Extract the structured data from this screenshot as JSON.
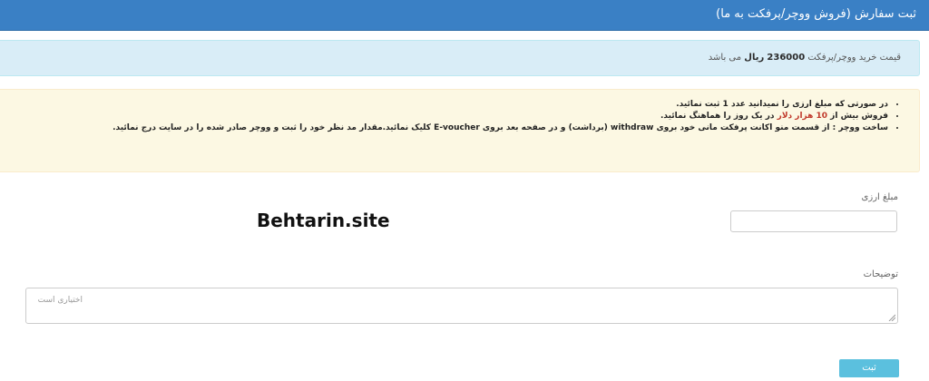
{
  "header": {
    "title": "ثبت سفارش (فروش ووچر/پرفکت به ما)"
  },
  "info": {
    "prefix": "قیمت خرید ووچر/پرفکت",
    "price": "236000",
    "unit": "ریال",
    "suffix": "می باشد"
  },
  "notes": {
    "item1": "در صورتی که مبلغ ارزی را نمیدانید عدد 1 ثبت نمائید.",
    "item2_a": "فروش بیش از ",
    "item2_highlight": "10 هزار دلار",
    "item2_b": " در یک روز را هماهنگ نمائید.",
    "item3": "ساخت ووچر : از قسمت منو اکانت پرفکت مانی خود بروی withdraw (برداشت)  و در صفحه بعد بروی E-voucher کلیک نمائید.مقدار مد نظر خود را ثبت و ووچر صادر شده را در سایت درج نمائید."
  },
  "form": {
    "amount_label": "مبلغ ارزی",
    "amount_value": "",
    "description_label": "توضیحات",
    "description_placeholder": "اختیاری است",
    "submit_label": "ثبت"
  },
  "watermark": "Behtarin.site",
  "colors": {
    "header_bg": "#3a80c5",
    "info_bg": "#d9edf7",
    "warning_bg": "#fcf8e3",
    "submit_bg": "#5bc0de",
    "highlight": "#c0392b"
  }
}
